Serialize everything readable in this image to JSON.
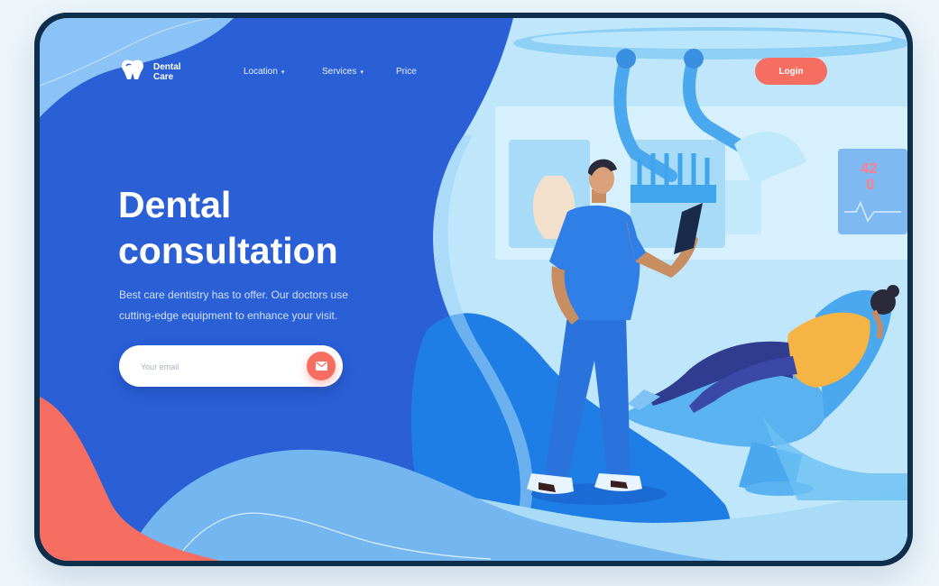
{
  "brand": {
    "name": "Dental Care",
    "logo_icon": "tooth-icon"
  },
  "nav": {
    "items": [
      {
        "label": "Location",
        "has_dropdown": true
      },
      {
        "label": "Services",
        "has_dropdown": true
      },
      {
        "label": "Price",
        "has_dropdown": false
      }
    ],
    "caret": "▾",
    "login_label": "Login"
  },
  "hero": {
    "title_line1": "Dental",
    "title_line2": "consultation",
    "description_line1": "Best care dentistry has to offer. Our doctors use",
    "description_line2": "cutting-edge equipment to enhance your visit.",
    "email_placeholder": "Your email",
    "email_value": "",
    "submit_icon": "envelope-icon"
  },
  "monitor_readout": {
    "top": "42",
    "bottom": "0"
  },
  "colors": {
    "primary_blue": "#2a5fd6",
    "light_blue": "#bfe6fb",
    "accent_coral": "#f66e62",
    "frame": "#0f2e4c",
    "patient_shirt": "#f5b443"
  }
}
